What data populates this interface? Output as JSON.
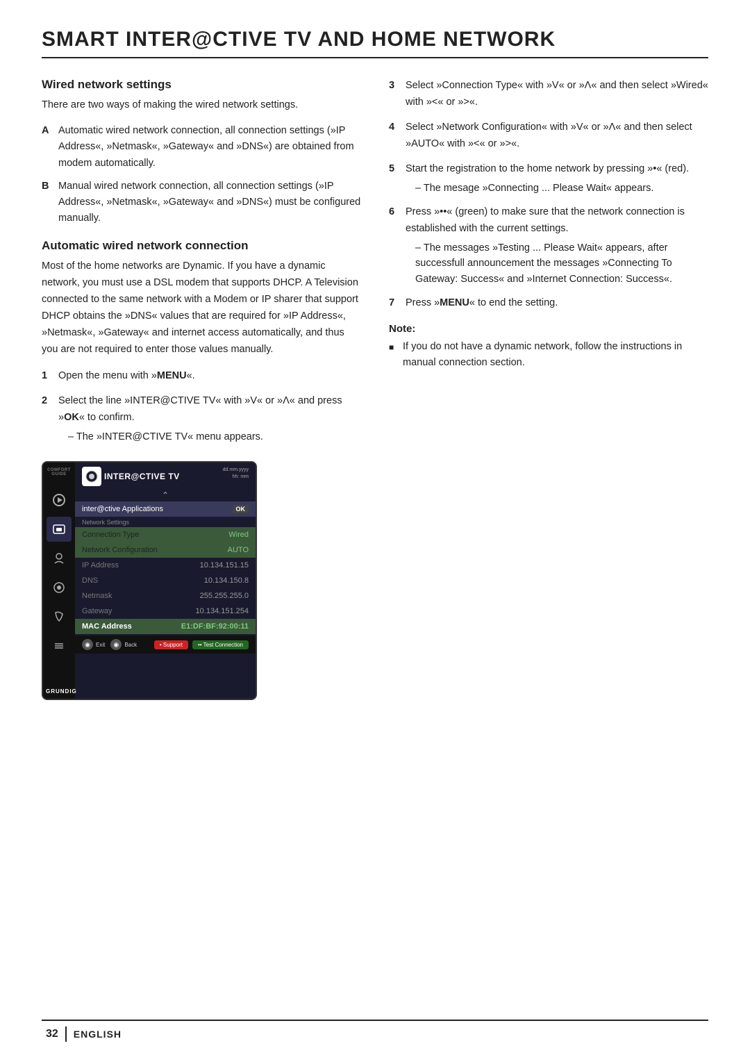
{
  "page": {
    "title": "SMART INTER@CTIVE TV AND HOME NETWORK",
    "footer": {
      "page_number": "32",
      "language": "ENGLISH"
    }
  },
  "left_col": {
    "section1": {
      "title": "Wired network settings",
      "intro": "There are two ways of making the wired network settings.",
      "list": [
        {
          "label": "A",
          "text": "Automatic wired network connection, all connection settings (»IP Address«, »Netmask«, »Gateway« and »DNS«) are obtained from modem automatically."
        },
        {
          "label": "B",
          "text": "Manual wired network connection, all connection settings (»IP Address«, »Netmask«, »Gateway« and »DNS«) must be configured manually."
        }
      ]
    },
    "section2": {
      "title": "Automatic wired network connection",
      "body": "Most of the home networks are Dynamic. If you have a dynamic network, you must use a DSL modem that supports DHCP. A Television connected to the same network with a Modem or IP sharer that support DHCP obtains the »DNS« values that are required for »IP Address«, »Netmask«, »Gateway« and internet access automatically, and thus you are not required to enter those values manually."
    },
    "numbered_steps_left": [
      {
        "num": "1",
        "text": "Open the menu with »MENU«.",
        "bold_parts": [
          "MENU"
        ]
      },
      {
        "num": "2",
        "text": "Select the line »INTER@CTIVE TV« with »V« or »Λ« and press »OK« to confirm.",
        "sub": "– The »INTER@CTIVE TV« menu appears.",
        "bold_parts": [
          "OK"
        ]
      }
    ]
  },
  "right_col": {
    "numbered_steps_right": [
      {
        "num": "3",
        "text": "Select »Connection Type« with »V« or »Λ« and then select »Wired« with »<« or »>«."
      },
      {
        "num": "4",
        "text": "Select »Network Configuration« with »V« or »Λ« and then select »AUTO« with »<« or »>«."
      },
      {
        "num": "5",
        "text": "Start the registration to the home network by pressing »•« (red).",
        "sub": "– The mesage »Connecting ... Please Wait« appears."
      },
      {
        "num": "6",
        "text": "Press »••«  (green) to make sure that the network connection is established with the current settings.",
        "sub": "– The messages »Testing ... Please Wait« appears, after successfull announcement the messages »Connecting To Gateway: Success« and »Internet Connection: Success«."
      },
      {
        "num": "7",
        "text": "Press »MENU« to end the setting.",
        "bold_parts": [
          "MENU"
        ]
      }
    ],
    "note": {
      "title": "Note:",
      "items": [
        "If you do not have a dynamic network, follow the instructions in manual connection section."
      ]
    }
  },
  "tv_screen": {
    "comfort_guide": "COMFORT GUIDE",
    "logo_text": "INTER@CTIVE TV",
    "time_line1": "dd.mm.yyyy",
    "time_line2": "hh: mm",
    "menu_item_applications": "inter@ctive Applications",
    "menu_item_applications_badge": "OK",
    "network_settings_label": "Network Settings",
    "rows": [
      {
        "label": "Connection Type",
        "value": "Wired",
        "style": "active"
      },
      {
        "label": "Network Configuration",
        "value": "AUTO",
        "style": "active"
      },
      {
        "label": "IP Address",
        "value": "10.134.151.15",
        "style": "inactive"
      },
      {
        "label": "DNS",
        "value": "10.134.150.8",
        "style": "inactive"
      },
      {
        "label": "Netmask",
        "value": "255.255.255.0",
        "style": "inactive"
      },
      {
        "label": "Gateway",
        "value": "10.134.151.254",
        "style": "inactive"
      },
      {
        "label": "MAC Address",
        "value": "E1:DF:BF:92:00:11",
        "style": "active"
      }
    ],
    "bottom_left_label": "Exit",
    "bottom_left_label2": "Back",
    "bottom_right1": "• Support",
    "bottom_right2": "•• Test Connection",
    "grundig": "GRUNDIG"
  }
}
